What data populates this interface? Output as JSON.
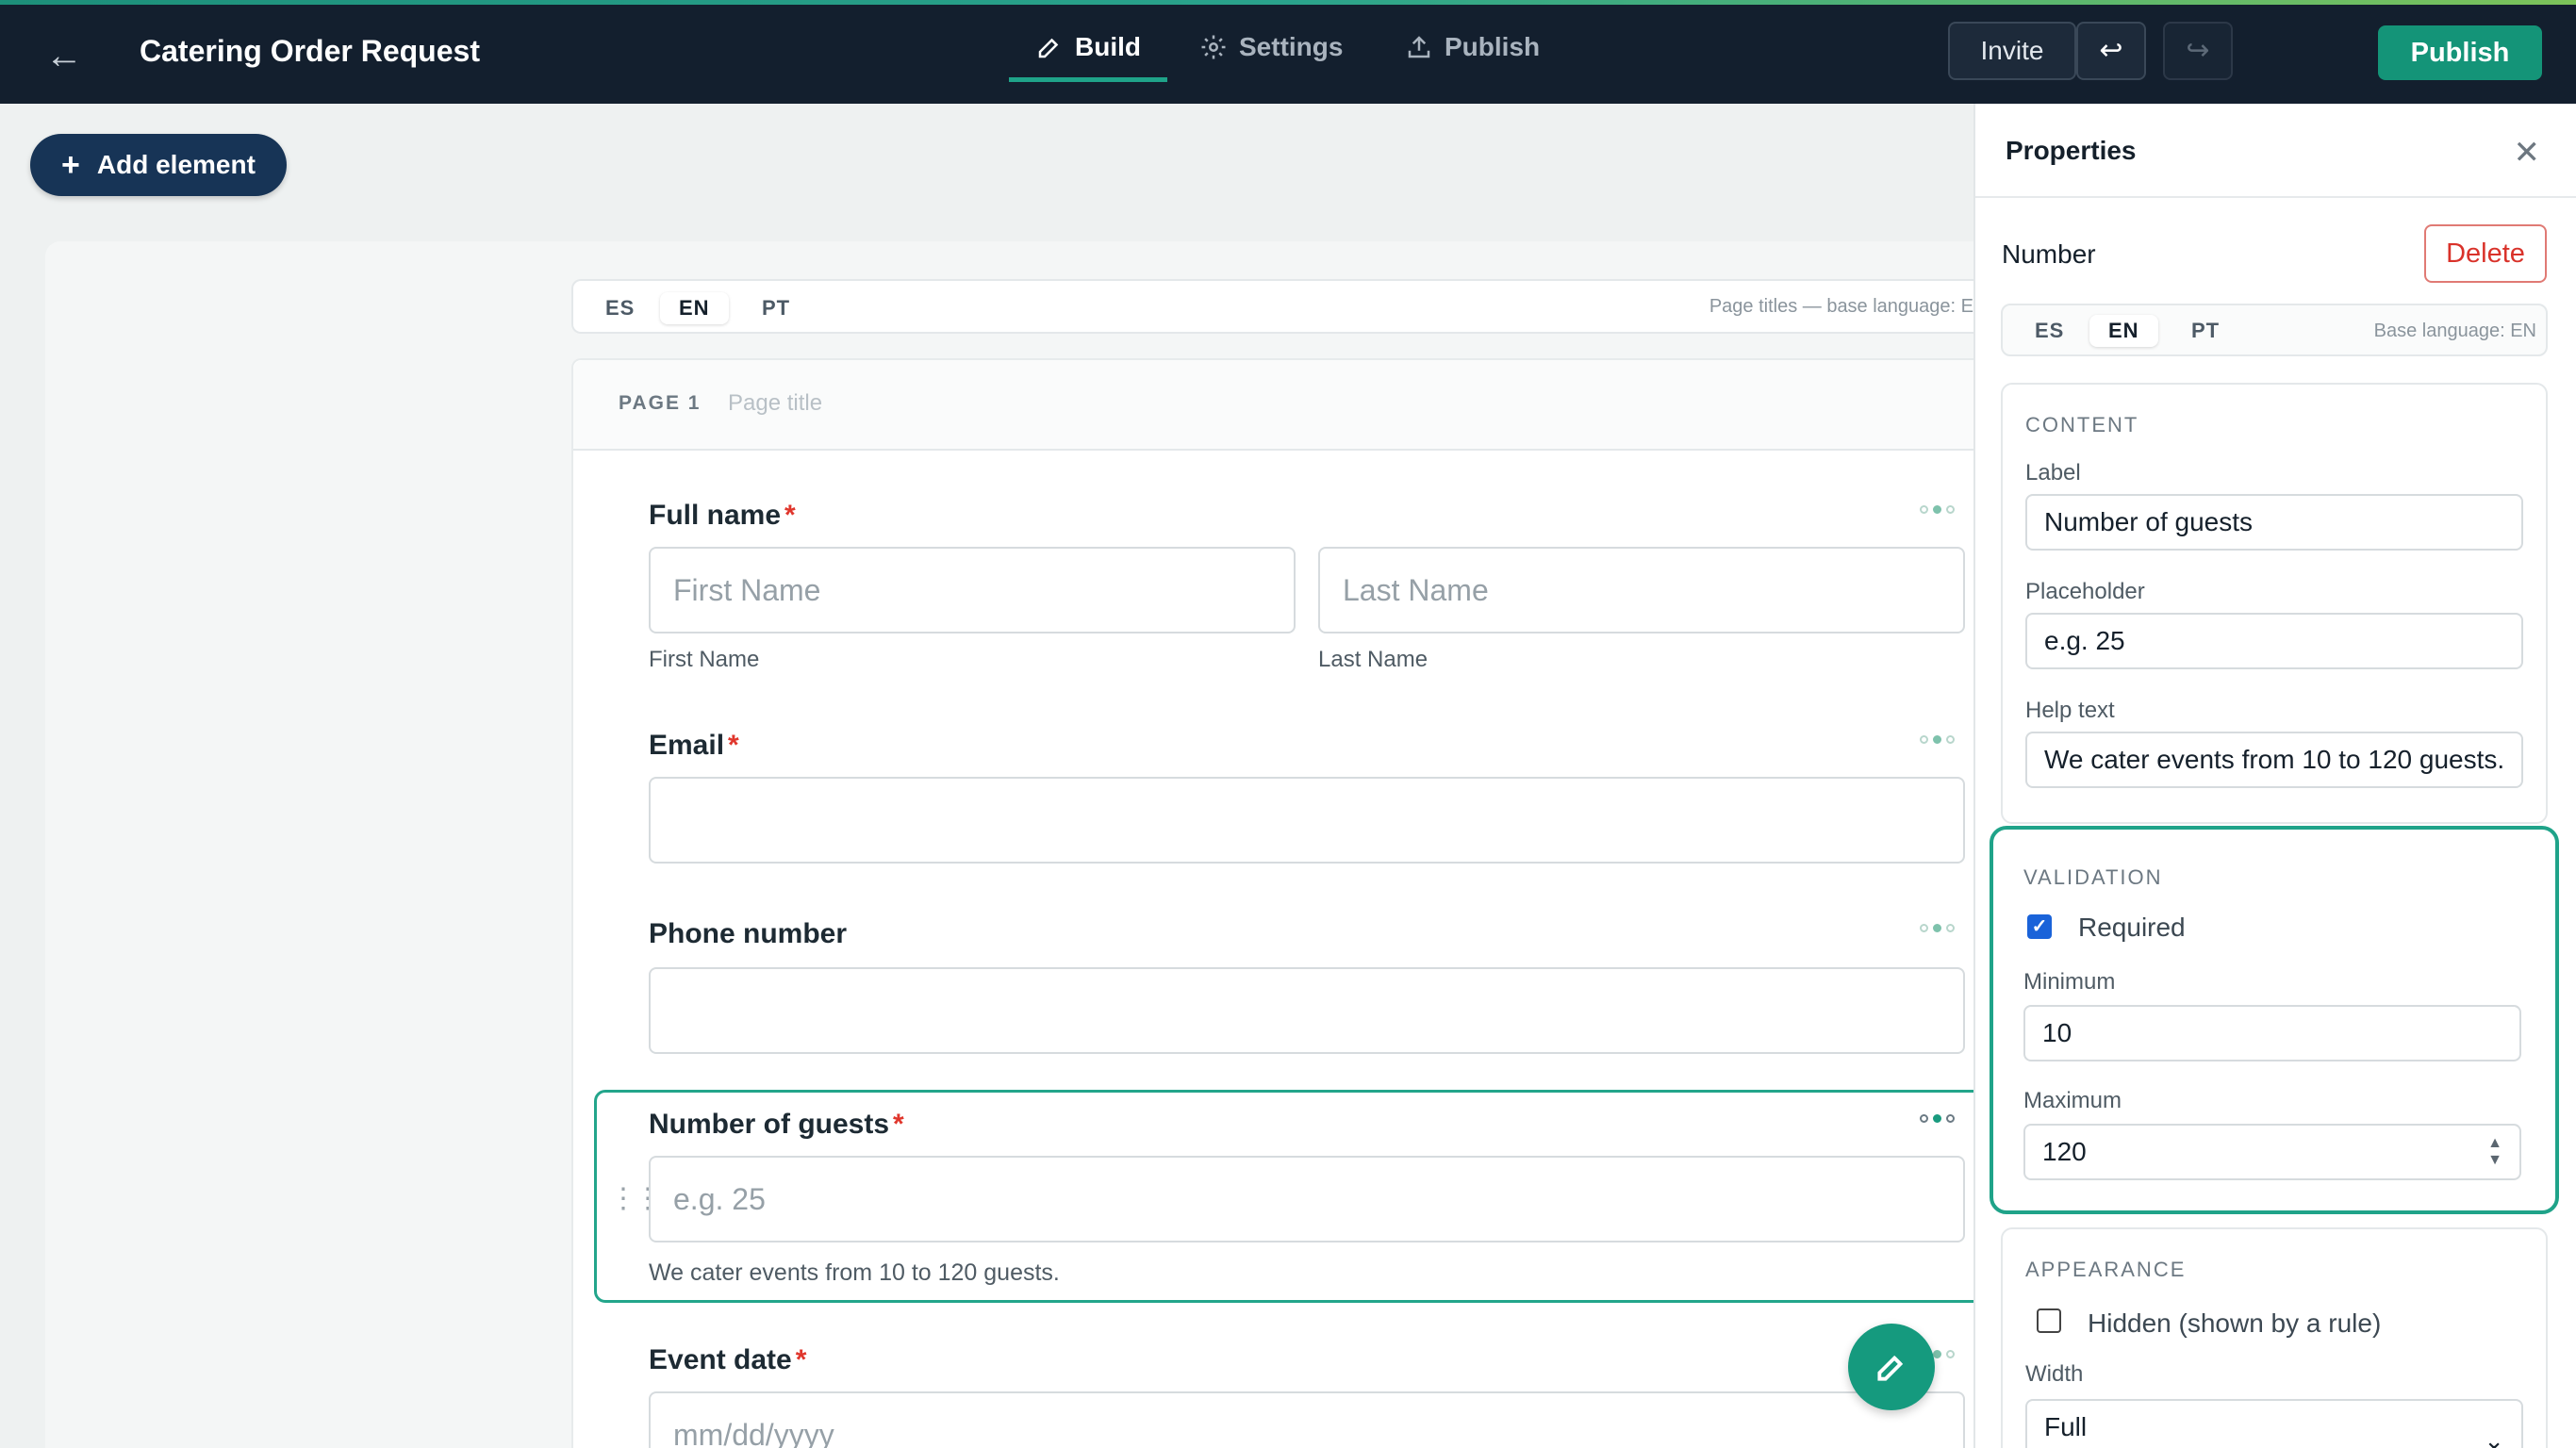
{
  "header": {
    "back_icon": "arrow-left-icon",
    "title": "Catering Order Request",
    "tabs": [
      {
        "label": "Build",
        "icon": "pencil-icon",
        "active": true
      },
      {
        "label": "Settings",
        "icon": "gear-icon",
        "active": false
      },
      {
        "label": "Publish",
        "icon": "upload-icon",
        "active": false
      }
    ],
    "invite_label": "Invite",
    "undo_icon": "undo-icon",
    "redo_icon": "redo-icon",
    "publish_label": "Publish",
    "accent_color": "#149478"
  },
  "toolbar": {
    "add_element_label": "Add element"
  },
  "canvas": {
    "languages": [
      "ES",
      "EN",
      "PT"
    ],
    "active_language": "EN",
    "language_note": "Page titles — base language: E",
    "page": {
      "label": "PAGE 1",
      "title_placeholder": "Page title"
    },
    "fields": {
      "full_name": {
        "label": "Full name",
        "required_mark": "*",
        "first_placeholder": "First Name",
        "last_placeholder": "Last Name",
        "first_sublabel": "First Name",
        "last_sublabel": "Last Name"
      },
      "email": {
        "label": "Email",
        "required_mark": "*"
      },
      "phone": {
        "label": "Phone number"
      },
      "guests": {
        "label": "Number of guests",
        "required_mark": "*",
        "placeholder": "e.g. 25",
        "help": "We cater events from 10 to 120 guests."
      },
      "event_date": {
        "label": "Event date",
        "required_mark": "*",
        "placeholder": "mm/dd/yyyy"
      }
    }
  },
  "properties": {
    "title": "Properties",
    "close_icon": "close-icon",
    "element_type": "Number",
    "delete_label": "Delete",
    "languages": [
      "ES",
      "EN",
      "PT"
    ],
    "active_language": "EN",
    "language_note": "Base language: EN",
    "content": {
      "title": "CONTENT",
      "label_label": "Label",
      "label_value": "Number of guests",
      "placeholder_label": "Placeholder",
      "placeholder_value": "e.g. 25",
      "help_label": "Help text",
      "help_value": "We cater events from 10 to 120 guests."
    },
    "validation": {
      "title": "VALIDATION",
      "required_label": "Required",
      "required_checked": true,
      "minimum_label": "Minimum",
      "minimum_value": "10",
      "maximum_label": "Maximum",
      "maximum_value": "120"
    },
    "appearance": {
      "title": "APPEARANCE",
      "hidden_label": "Hidden (shown by a rule)",
      "hidden_checked": false,
      "width_label": "Width",
      "width_value": "Full"
    }
  }
}
